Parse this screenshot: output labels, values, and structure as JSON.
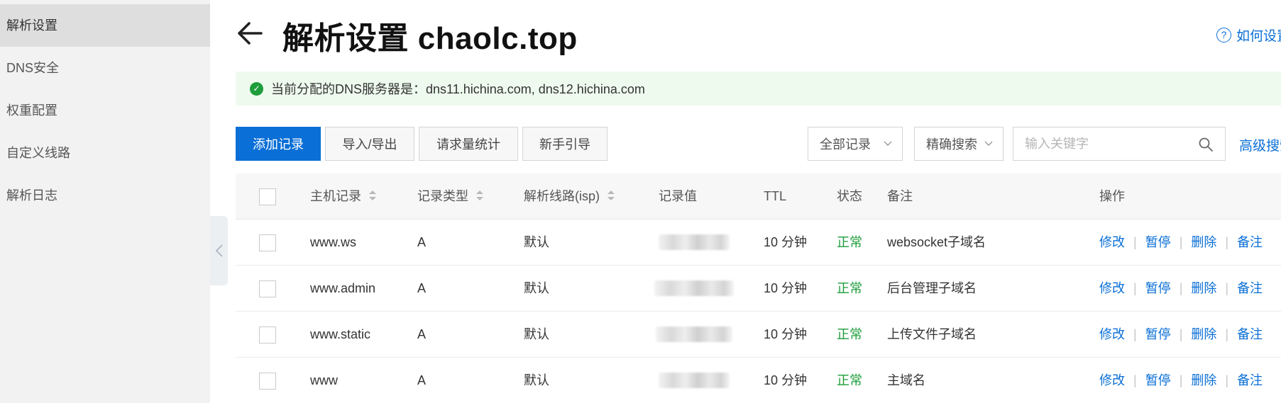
{
  "sidebar": {
    "items": [
      {
        "label": "解析设置",
        "active": true
      },
      {
        "label": "DNS安全",
        "active": false
      },
      {
        "label": "权重配置",
        "active": false
      },
      {
        "label": "自定义线路",
        "active": false
      },
      {
        "label": "解析日志",
        "active": false
      }
    ],
    "collapse_icon": "chevron-left-icon"
  },
  "header": {
    "title": "解析设置 chaolc.top",
    "help_link": "如何设置"
  },
  "notice": {
    "text": "当前分配的DNS服务器是：dns11.hichina.com, dns12.hichina.com",
    "icon": "check-circle-icon",
    "color": "#1e9d3b"
  },
  "toolbar": {
    "add_label": "添加记录",
    "import_export_label": "导入/导出",
    "stats_label": "请求量统计",
    "guide_label": "新手引导",
    "filter_select": "全部记录",
    "search_mode_select": "精确搜索",
    "search_placeholder": "输入关键字",
    "search_value": "",
    "advanced_search_label": "高级搜索"
  },
  "table": {
    "headers": {
      "host": "主机记录",
      "type": "记录类型",
      "line": "解析线路(isp)",
      "value": "记录值",
      "ttl": "TTL",
      "status": "状态",
      "remark": "备注",
      "actions": "操作"
    },
    "rows": [
      {
        "host": "www.ws",
        "type": "A",
        "line": "默认",
        "ttl": "10 分钟",
        "status": "正常",
        "remark": "websocket子域名"
      },
      {
        "host": "www.admin",
        "type": "A",
        "line": "默认",
        "ttl": "10 分钟",
        "status": "正常",
        "remark": "后台管理子域名"
      },
      {
        "host": "www.static",
        "type": "A",
        "line": "默认",
        "ttl": "10 分钟",
        "status": "正常",
        "remark": "上传文件子域名"
      },
      {
        "host": "www",
        "type": "A",
        "line": "默认",
        "ttl": "10 分钟",
        "status": "正常",
        "remark": "主域名"
      }
    ],
    "actions": [
      "修改",
      "暂停",
      "删除",
      "备注"
    ]
  },
  "colors": {
    "primary": "#0a6fd6",
    "success": "#1e9d3b",
    "sidebar_bg": "#f2f2f2",
    "notice_bg": "#eefaee"
  }
}
